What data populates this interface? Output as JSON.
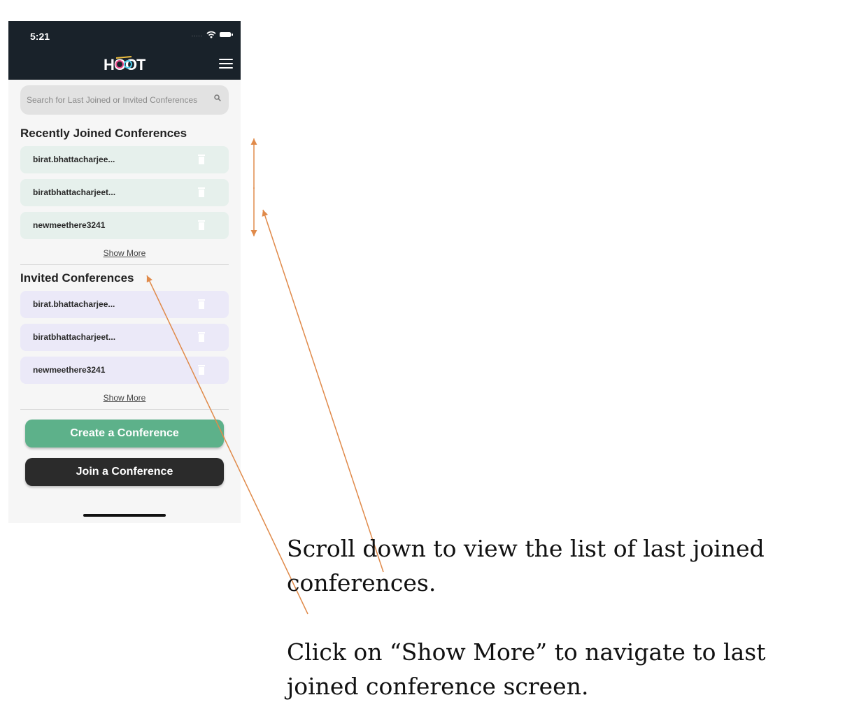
{
  "status_bar": {
    "time": "5:21",
    "signal": "....."
  },
  "header": {
    "logo_text": "HOOT"
  },
  "search": {
    "placeholder": "Search for Last Joined or Invited Conferences"
  },
  "recent": {
    "title": "Recently Joined Conferences",
    "items": [
      {
        "label": "birat.bhattacharjee..."
      },
      {
        "label": "biratbhattacharjeet..."
      },
      {
        "label": "newmeethere3241"
      }
    ],
    "show_more": "Show More"
  },
  "invited": {
    "title": "Invited Conferences",
    "items": [
      {
        "label": "birat.bhattacharjee..."
      },
      {
        "label": "biratbhattacharjeet..."
      },
      {
        "label": "newmeethere3241"
      }
    ],
    "show_more": "Show More"
  },
  "actions": {
    "create": "Create a Conference",
    "join": "Join a Conference"
  },
  "annotations": {
    "scroll_note": "Scroll down to view the list of last joined conferences.",
    "show_more_note": "Click on “Show More” to navigate to last joined conference screen."
  },
  "colors": {
    "header_bg": "#19222a",
    "joined_item_bg": "#e6f0ec",
    "invited_item_bg": "#ebe9f8",
    "create_button": "#5db18a",
    "join_button": "#2b2b2b",
    "annotation_arrow": "#e08a4a"
  },
  "icons": {
    "search": "search-icon",
    "menu": "hamburger-menu-icon",
    "delete": "trash-icon",
    "wifi": "wifi-icon",
    "battery": "battery-icon"
  }
}
